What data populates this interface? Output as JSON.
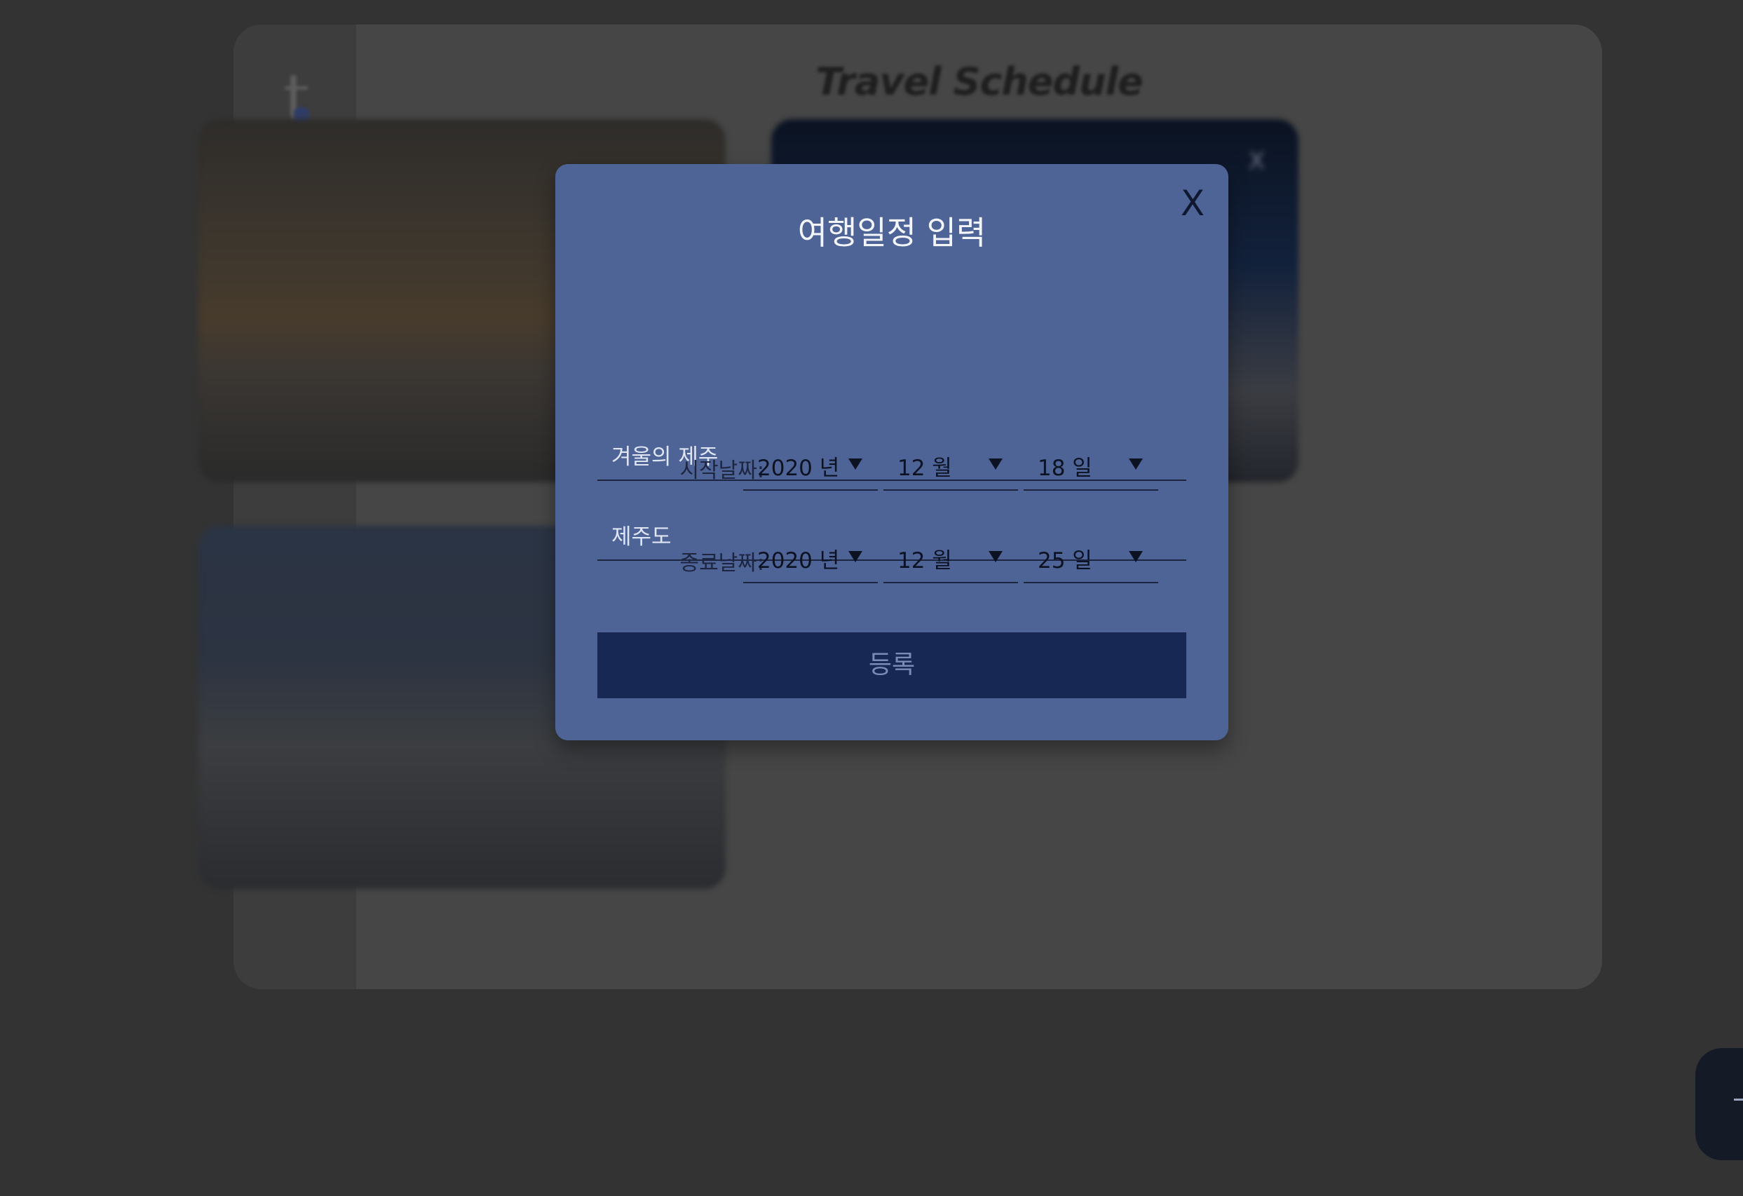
{
  "background": {
    "page_title": "Travel Schedule",
    "logo_letter": "t",
    "cards": [
      {
        "title": "",
        "line1": "",
        "line2": ""
      },
      {
        "title": "",
        "line1": "",
        "line2": "",
        "close_label": "X"
      },
      {
        "title": "",
        "line1": "",
        "line2": ""
      }
    ]
  },
  "modal": {
    "title": "여행일정 입력",
    "close_label": "X",
    "trip_name": {
      "value": "",
      "placeholder": "겨울의 제주"
    },
    "destination": {
      "value": "",
      "placeholder": "제주도"
    },
    "start_date": {
      "label": "시작날짜:",
      "year": "2020 년",
      "month": "12 월",
      "day": "18 일"
    },
    "end_date": {
      "label": "종료날짜:",
      "year": "2020 년",
      "month": "12 월",
      "day": "25 일"
    },
    "submit_label": "등록"
  },
  "colors": {
    "modal_bg": "#4e6497",
    "submit_bg": "#162853",
    "overlay": "#333333"
  }
}
